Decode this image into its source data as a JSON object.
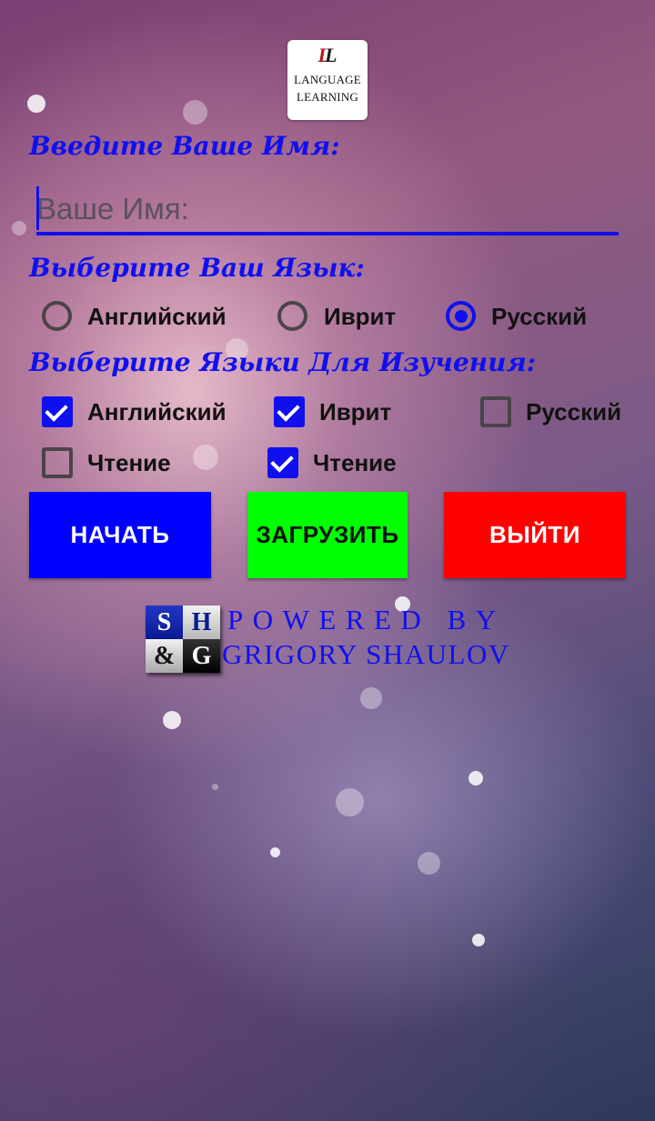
{
  "logo": {
    "mark_left": "L",
    "mark_right": "L",
    "line1": "LANGUAGE",
    "line2": "LEARNING"
  },
  "name_section": {
    "label": "Введите Ваше Имя:",
    "input_value": "",
    "input_placeholder": "Ваше Имя:"
  },
  "language_section": {
    "label": "Выберите Ваш Язык:",
    "options": [
      {
        "label": "Английский",
        "selected": false
      },
      {
        "label": "Иврит",
        "selected": false
      },
      {
        "label": "Русский",
        "selected": true
      }
    ]
  },
  "study_section": {
    "label": "Выберите Языки Для Изучения:",
    "options": [
      {
        "label": "Английский",
        "checked": true
      },
      {
        "label": "Иврит",
        "checked": true
      },
      {
        "label": "Русский",
        "checked": false
      },
      {
        "label": "Чтение",
        "checked": false
      },
      {
        "label": "Чтение",
        "checked": true
      }
    ]
  },
  "buttons": {
    "start": {
      "label": "НАЧАТЬ",
      "color": "#0000FF"
    },
    "load": {
      "label": "ЗАГРУЗИТЬ",
      "color": "#00FF00"
    },
    "exit": {
      "label": "ВЫЙТИ",
      "color": "#FF0000"
    }
  },
  "footer": {
    "badge": {
      "tl": "S",
      "tr": "H",
      "bl": "&",
      "br": "G"
    },
    "powered_by": "POWERED BY",
    "author": "GRIGORY SHAULOV"
  },
  "colors": {
    "accent": "#1010EE",
    "text": "#111111"
  }
}
